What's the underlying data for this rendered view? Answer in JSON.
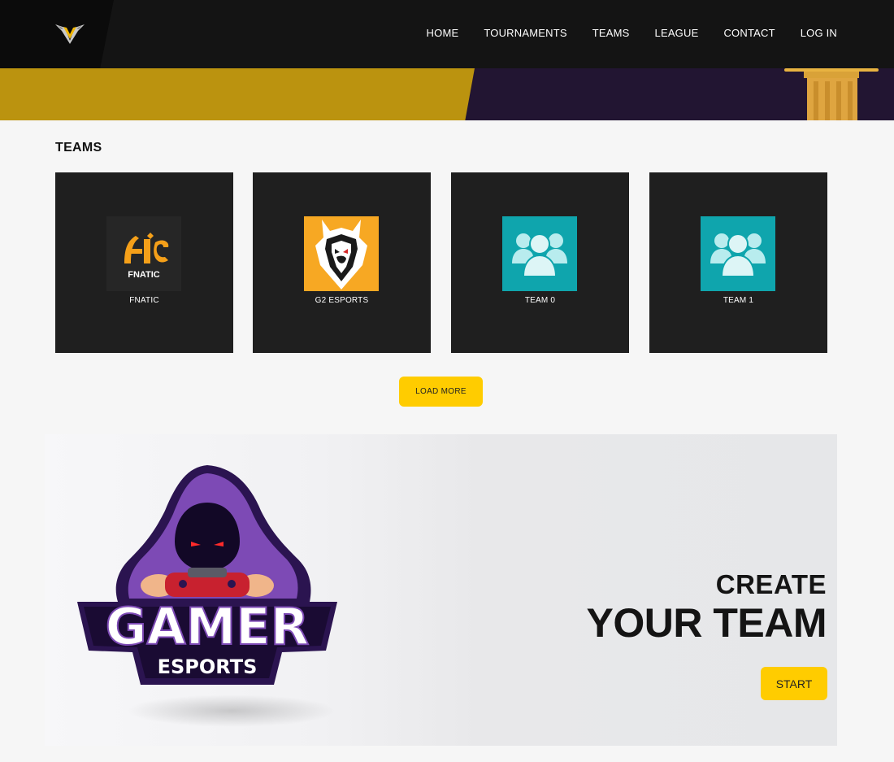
{
  "header": {
    "logo_icon": "v-wing-logo-icon",
    "nav": [
      {
        "label": "HOME"
      },
      {
        "label": "TOURNAMENTS"
      },
      {
        "label": "TEAMS"
      },
      {
        "label": "LEAGUE"
      },
      {
        "label": "CONTACT"
      },
      {
        "label": "LOG IN"
      }
    ]
  },
  "hero": {
    "colors": {
      "gold": "#bb930f",
      "purple": "#221532"
    }
  },
  "teams": {
    "title": "TEAMS",
    "items": [
      {
        "name": "FNATIC",
        "logo_text": "FNATIC",
        "image_icon": "fnatic-logo-icon",
        "image_bg": "#262626"
      },
      {
        "name": "G2 ESPORTS",
        "image_icon": "g2-samurai-logo-icon",
        "image_bg": "#f7a823"
      },
      {
        "name": "TEAM 0",
        "image_icon": "group-users-icon",
        "image_bg": "#0fa5ad"
      },
      {
        "name": "TEAM 1",
        "image_icon": "group-users-icon",
        "image_bg": "#0fa5ad"
      }
    ],
    "load_more_label": "LOAD MORE"
  },
  "banner": {
    "logo_text_main": "GAMER",
    "logo_text_sub": "ESPORTS",
    "heading_line1": "CREATE",
    "heading_line2": "YOUR TEAM",
    "start_label": "START"
  },
  "colors": {
    "accent": "#ffcc00",
    "card_bg": "#1f1f1f",
    "header_bg": "#141414"
  }
}
